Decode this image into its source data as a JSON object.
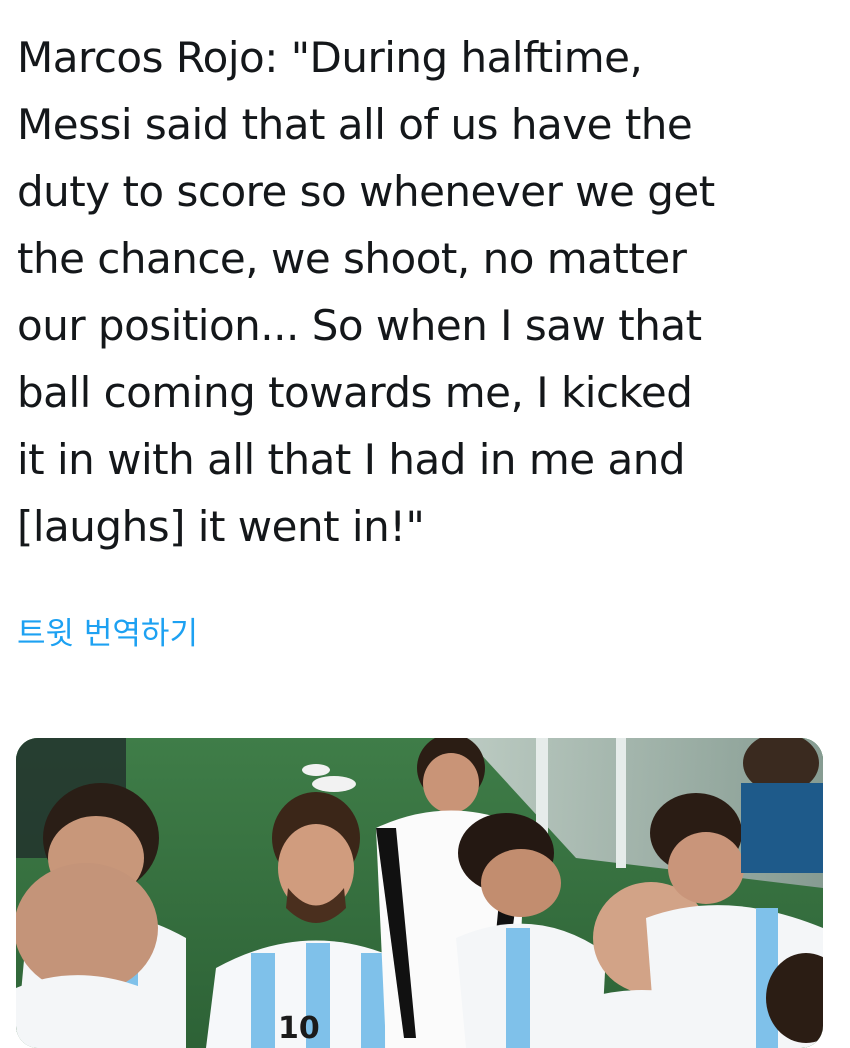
{
  "tweet": {
    "text": "Marcos Rojo: \"During halftime,\nMessi said that all of us have the\nduty to score so whenever we get\nthe chance, we shoot, no matter\nour position... So when I saw that\nball coming towards me, I kicked\nit in with all that I had in me and\n[laughs] it went in!\"",
    "translate_label": "트윗 번역하기"
  },
  "media": {
    "jersey_number": "10"
  }
}
